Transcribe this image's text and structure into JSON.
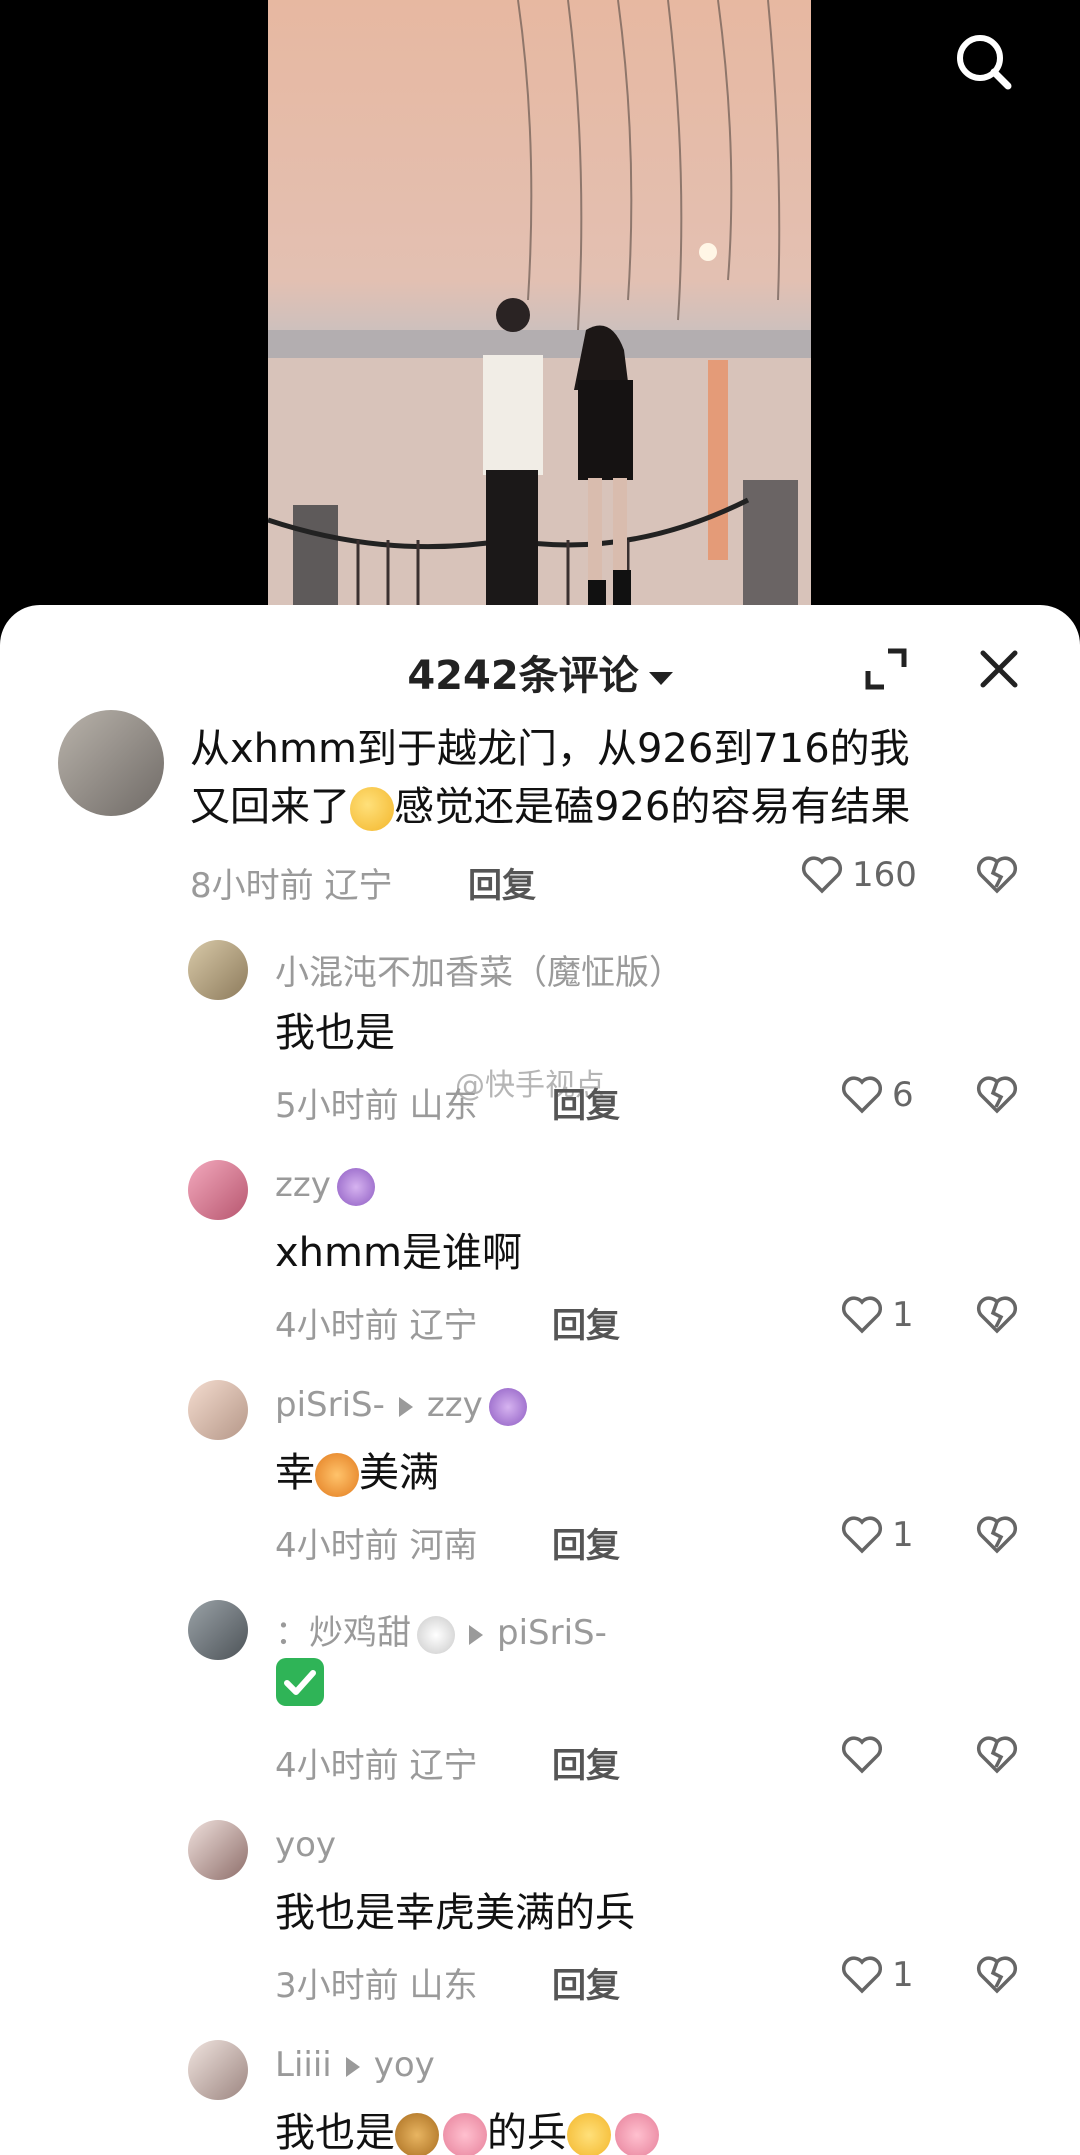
{
  "header": {
    "comment_count_title": "4242条评论",
    "search_icon": "search-icon",
    "expand_icon": "expand-icon",
    "close_icon": "close-icon"
  },
  "watermark": "@快手视点",
  "main_comment": {
    "text_line1": "从xhmm到于越龙门，从926到716的我",
    "text_line2_a": "又回来了",
    "text_line2_b": "感觉还是磕926的容易有结果",
    "time": "8小时前",
    "location": "辽宁",
    "reply_label": "回复",
    "likes": "160"
  },
  "replies": [
    {
      "author": "小混沌不加香菜（魔怔版）",
      "reply_to": "",
      "text": "我也是",
      "time": "5小时前",
      "location": "山东",
      "reply_label": "回复",
      "likes": "6"
    },
    {
      "author": "zzy",
      "reply_to": "",
      "text": "xhmm是谁啊",
      "time": "4小时前",
      "location": "辽宁",
      "reply_label": "回复",
      "likes": "1"
    },
    {
      "author": "piSriS-",
      "reply_to": "zzy",
      "text_a": "幸",
      "text_b": "美满",
      "time": "4小时前",
      "location": "河南",
      "reply_label": "回复",
      "likes": "1"
    },
    {
      "author": "：炒鸡甜",
      "reply_to": "piSriS-",
      "text": "",
      "time": "4小时前",
      "location": "辽宁",
      "reply_label": "回复",
      "likes": ""
    },
    {
      "author": "yoy",
      "reply_to": "",
      "text": "我也是幸虎美满的兵",
      "time": "3小时前",
      "location": "山东",
      "reply_label": "回复",
      "likes": "1"
    },
    {
      "author": "Liiii",
      "reply_to": "yoy",
      "text_a": "我也是",
      "text_b": "的兵"
    }
  ],
  "colors": {
    "accent_text": "#111111",
    "meta": "#9a9a9a",
    "sheet_bg": "#ffffff"
  }
}
